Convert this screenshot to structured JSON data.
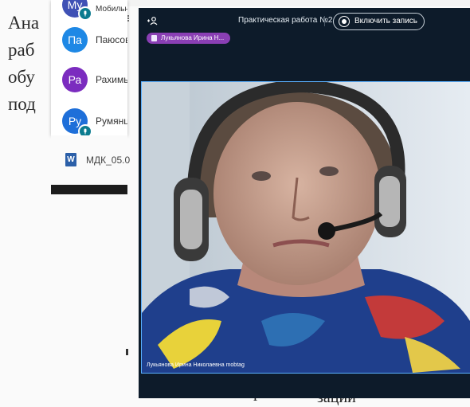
{
  "document": {
    "lines": [
      "Ана",
      "раб",
      "обу",
      "под"
    ],
    "bottom_fragment": "г",
    "bottom_fragment2": "зации"
  },
  "participants": [
    {
      "initials": "Му",
      "name": "Мобильна",
      "color": "#3f51b5",
      "mic": true
    },
    {
      "initials": "Па",
      "name": "Паюсова",
      "color": "#1e88e5",
      "mic": false
    },
    {
      "initials": "Ра",
      "name": "Рахимья",
      "color": "#7b2cbf",
      "mic": false
    },
    {
      "initials": "Ру",
      "name": "Румянце",
      "color": "#1e6fd9",
      "mic": true
    }
  ],
  "file": {
    "icon_letter": "W",
    "name": "МДК_05.0"
  },
  "conference": {
    "title": "Практическая работа №2",
    "record_label": "Включить запись",
    "speaker_name": "Лукьянова Ирина Н...",
    "video_caption": "Лукьянова Ирина Николаевна mobtag"
  },
  "colors": {
    "conf_bg": "#0d1b2a",
    "speaker_pill": "#8a3fb4",
    "accent_border": "#5ab0ff"
  }
}
